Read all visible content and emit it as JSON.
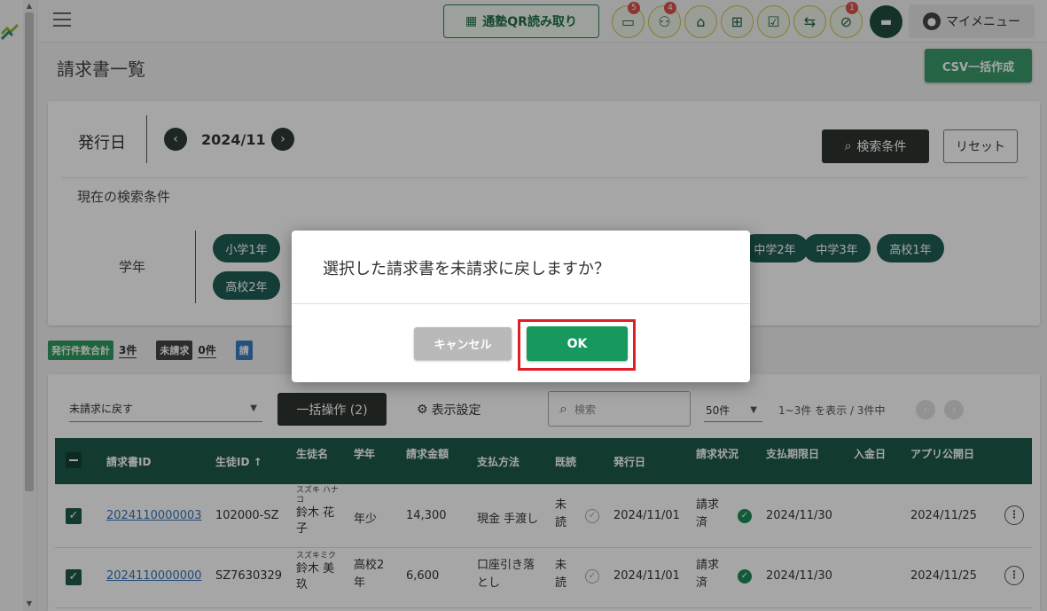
{
  "header": {
    "qr_button": "通塾QR読み取り",
    "icons": [
      {
        "name": "message-icon",
        "badge": "5"
      },
      {
        "name": "group-icon",
        "badge": "4"
      },
      {
        "name": "school-icon",
        "badge": ""
      },
      {
        "name": "gift-icon",
        "badge": ""
      },
      {
        "name": "checklist-icon",
        "badge": ""
      },
      {
        "name": "collapse-icon",
        "badge": ""
      },
      {
        "name": "blocked-icon",
        "badge": "1"
      }
    ],
    "my_menu": "マイメニュー"
  },
  "page": {
    "title": "請求書一覧",
    "csv_button": "CSV一括作成"
  },
  "filter": {
    "issue_label": "発行日",
    "issue_date": "2024/11",
    "search_conditions_button": "検索条件",
    "reset_button": "リセット",
    "current_conditions_label": "現在の検索条件",
    "grade_label": "学年",
    "grade_chips": [
      "小学1年",
      "中学2年",
      "中学3年",
      "高校1年",
      "高校2年"
    ]
  },
  "stats": [
    {
      "label": "発行件数合計",
      "value": "3件",
      "color": "#2e9a5e"
    },
    {
      "label": "未請求",
      "value": "0件",
      "color": "#444444"
    },
    {
      "label": "請",
      "value": "",
      "color": "#3a7fc1"
    }
  ],
  "list": {
    "action_select": "未請求に戻す",
    "bulk_button": "一括操作 (2)",
    "display_settings": "表示設定",
    "search_placeholder": "検索",
    "per_page": "50件",
    "range_text": "1~3件 を表示 / 3件中",
    "columns": {
      "invoice_id": "請求書ID",
      "student_id": "生徒ID ↑",
      "student_name": "生徒名",
      "grade": "学年",
      "amount": "請求金額",
      "payment_method": "支払方法",
      "read": "既読",
      "issue_date": "発行日",
      "status": "請求状況",
      "due_date": "支払期限日",
      "deposit_date": "入金日",
      "app_publish_date": "アプリ公開日"
    },
    "rows": [
      {
        "invoice_id": "2024110000003",
        "student_id": "102000-SZ",
        "kana": "スズキ ハナコ",
        "name": "鈴木 花子",
        "grade": "年少",
        "amount": "14,300",
        "payment": "現金 手渡し",
        "read": "未読",
        "issue_date": "2024/11/01",
        "status": "請求済",
        "due_date": "2024/11/30",
        "deposit_date": "",
        "publish_date": "2024/11/25"
      },
      {
        "invoice_id": "2024110000000",
        "student_id": "SZ7630329",
        "kana": "スズキミク",
        "name": "鈴木 美玖",
        "grade": "高校2年",
        "amount": "6,600",
        "payment": "口座引き落とし",
        "read": "未読",
        "issue_date": "2024/11/01",
        "status": "請求済",
        "due_date": "2024/11/30",
        "deposit_date": "",
        "publish_date": "2024/11/25"
      }
    ]
  },
  "dialog": {
    "message": "選択した請求書を未請求に戻しますか？",
    "cancel_button": "キャンセル",
    "ok_button": "OK",
    "highlight_color": "#e01e25"
  }
}
